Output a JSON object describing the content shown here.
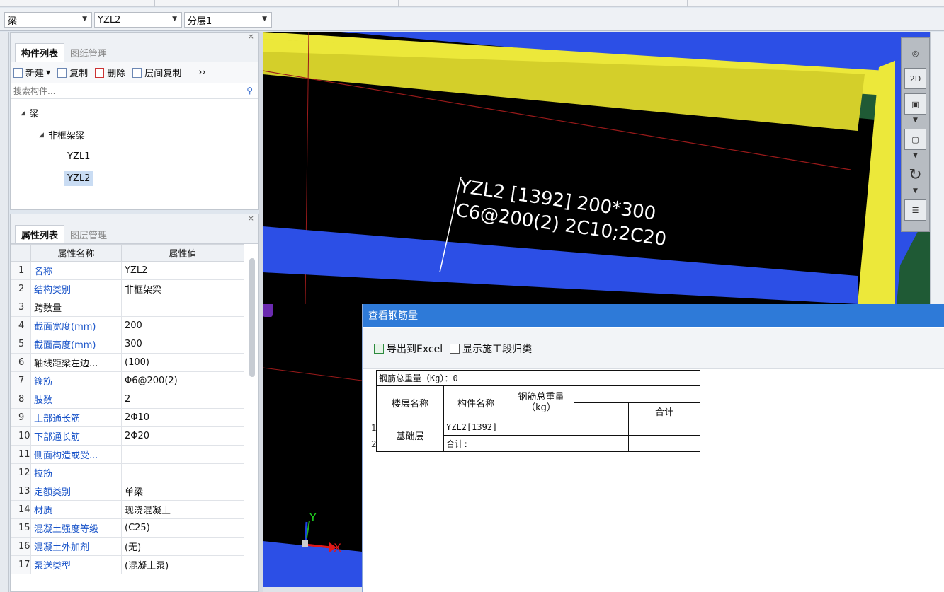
{
  "combo_bar": {
    "element_type": "梁",
    "component": "YZL2",
    "layer": "分层1"
  },
  "component_panel": {
    "tabs": [
      "构件列表",
      "图纸管理"
    ],
    "toolbar": {
      "new_label": "新建",
      "copy_label": "复制",
      "delete_label": "删除",
      "floor_copy_label": "层间复制",
      "more": "››"
    },
    "search_placeholder": "搜索构件...",
    "tree": {
      "root": "梁",
      "group": "非框架梁",
      "items": [
        "YZL1",
        "YZL2"
      ],
      "selected": "YZL2"
    }
  },
  "property_panel": {
    "tabs": [
      "属性列表",
      "图层管理"
    ],
    "headers": [
      "属性名称",
      "属性值"
    ],
    "rows": [
      {
        "idx": "1",
        "name": "名称",
        "value": "YZL2"
      },
      {
        "idx": "2",
        "name": "结构类别",
        "value": "非框架梁"
      },
      {
        "idx": "3",
        "name": "跨数量",
        "value": ""
      },
      {
        "idx": "4",
        "name": "截面宽度(mm)",
        "value": "200"
      },
      {
        "idx": "5",
        "name": "截面高度(mm)",
        "value": "300"
      },
      {
        "idx": "6",
        "name": "轴线距梁左边...",
        "value": "(100)"
      },
      {
        "idx": "7",
        "name": "箍筋",
        "value": "Φ6@200(2)"
      },
      {
        "idx": "8",
        "name": "肢数",
        "value": "2"
      },
      {
        "idx": "9",
        "name": "上部通长筋",
        "value": "2Φ10"
      },
      {
        "idx": "10",
        "name": "下部通长筋",
        "value": "2Φ20"
      },
      {
        "idx": "11",
        "name": "侧面构造或受...",
        "value": ""
      },
      {
        "idx": "12",
        "name": "拉筋",
        "value": ""
      },
      {
        "idx": "13",
        "name": "定额类别",
        "value": "单梁"
      },
      {
        "idx": "14",
        "name": "材质",
        "value": "现浇混凝土"
      },
      {
        "idx": "15",
        "name": "混凝土强度等级",
        "value": "(C25)"
      },
      {
        "idx": "16",
        "name": "混凝土外加剂",
        "value": "(无)"
      },
      {
        "idx": "17",
        "name": "泵送类型",
        "value": "(混凝土泵)"
      }
    ]
  },
  "viewport": {
    "beam_label_line1": "YZL2 [1392] 200*300",
    "beam_label_line2": "C6@200(2) 2C10;2C20",
    "axis_x": "X",
    "axis_y": "Y",
    "marker": "1",
    "view_2d_label": "2D",
    "colors": {
      "yellow": "#ece83a",
      "green": "#1f5a35",
      "blue": "#2c4fe6",
      "background": "#000000"
    }
  },
  "dialog": {
    "title": "查看钢筋量",
    "export_label": "导出到Excel",
    "checkbox_label": "显示施工段归类",
    "total_weight_label": "钢筋总重量（Kg）：0",
    "col_floor": "楼层名称",
    "col_component": "构件名称",
    "col_weight": "钢筋总重量\n（kg）",
    "col_total": "合计",
    "rows": [
      {
        "num": "1",
        "floor": "基础层",
        "component": "YZL2[1392]"
      },
      {
        "num": "2",
        "floor": "",
        "component": "合计:"
      }
    ]
  }
}
